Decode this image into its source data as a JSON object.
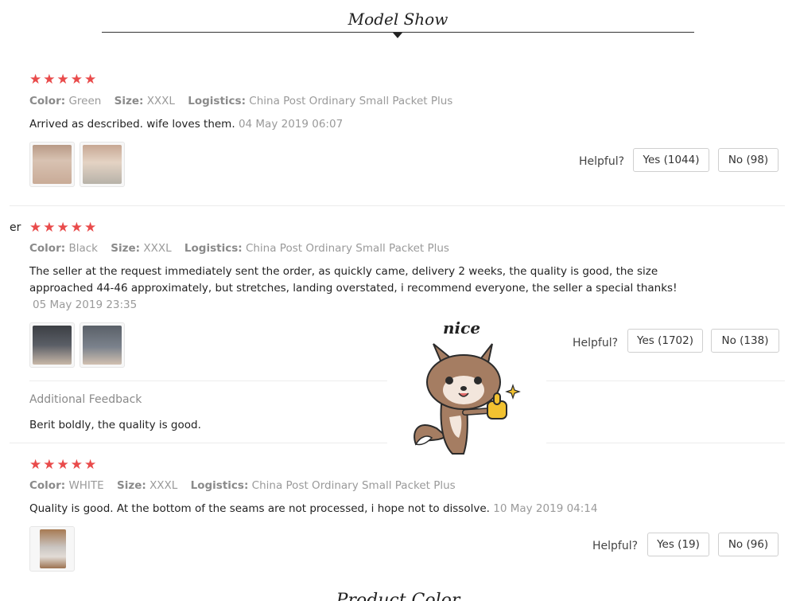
{
  "header": {
    "title": "Model Show"
  },
  "labels": {
    "color": "Color:",
    "size": "Size:",
    "logistics": "Logistics:",
    "helpful": "Helpful?"
  },
  "reviews": [
    {
      "stars": "★★★★★",
      "color": "Green",
      "size": "XXXL",
      "logistics": "China Post Ordinary Small Packet Plus",
      "text": "Arrived as described. wife loves them.",
      "date": "04 May 2019 06:07",
      "yes": "Yes (1044)",
      "no": "No (98)"
    },
    {
      "cut_prefix": "er",
      "stars": "★★★★★",
      "color": "Black",
      "size": "XXXL",
      "logistics": "China Post Ordinary Small Packet Plus",
      "text": "The seller at the request immediately sent the order, as quickly came, delivery 2 weeks, the quality is good, the size approached 44-46 approximately, but stretches, landing overstated, i recommend everyone, the seller a special thanks!",
      "date": "05 May 2019 23:35",
      "yes": "Yes (1702)",
      "no": "No (138)",
      "additional_title": "Additional Feedback",
      "additional_text": "Berit boldly, the quality is good."
    },
    {
      "stars": "★★★★★",
      "color": "WHITE",
      "size": "XXXL",
      "logistics": "China Post Ordinary Small Packet Plus",
      "text": "Quality is good. At the bottom of the seams are not processed, i hope not to dissolve.",
      "date": "10 May 2019 04:14",
      "yes": "Yes (19)",
      "no": "No (96)"
    }
  ],
  "sticker": {
    "text": "nice"
  },
  "footer": {
    "title": "Product Color"
  },
  "colors": {
    "star": "#e94b4b",
    "muted": "#9a9a9a"
  }
}
